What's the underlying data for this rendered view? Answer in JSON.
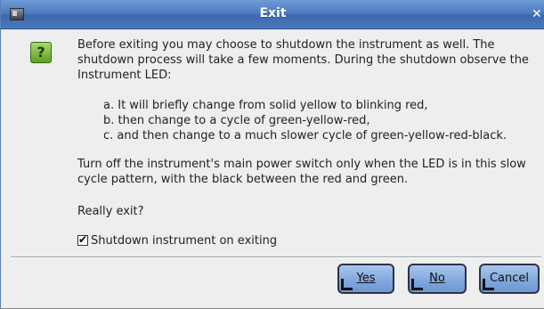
{
  "window": {
    "title": "Exit",
    "close_glyph": "✕"
  },
  "icon": {
    "name": "question-icon",
    "glyph": "?"
  },
  "message": {
    "intro": "Before exiting you may choose to shutdown the instrument as well. The shutdown process will take a few moments. During the shutdown observe the Instrument LED:",
    "steps": [
      "a. It will briefly change from solid yellow to blinking red,",
      "b. then change to a cycle of green-yellow-red,",
      "c. and then change to a much slower cycle of green-yellow-red-black."
    ],
    "warning": "Turn off the instrument's main power switch only when the LED is in this slow cycle pattern, with the black between the red and green.",
    "question": "Really exit?"
  },
  "checkbox": {
    "label": "Shutdown instrument on exiting",
    "checked": true,
    "check_glyph": "✔"
  },
  "buttons": {
    "yes": "Yes",
    "no": "No",
    "cancel": "Cancel"
  },
  "colors": {
    "titlebar": "#4d7cc0",
    "button": "#7fa6dc",
    "icon_green": "#7fbf3f"
  }
}
